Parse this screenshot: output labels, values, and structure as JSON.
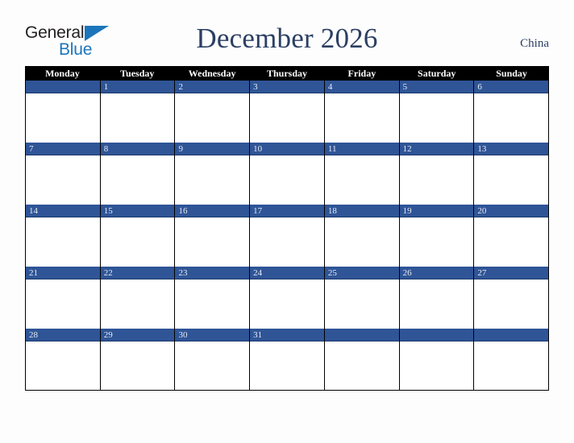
{
  "logo": {
    "word_primary": "General",
    "word_secondary": "Blue",
    "primary_color": "#231f20",
    "accent_color": "#1b75bb"
  },
  "header": {
    "title": "December 2026",
    "month": "December",
    "year": "2026",
    "country": "China",
    "title_color": "#2b3f63"
  },
  "calendar": {
    "weekdays": [
      "Monday",
      "Tuesday",
      "Wednesday",
      "Thursday",
      "Friday",
      "Saturday",
      "Sunday"
    ],
    "header_background": "#000000",
    "header_text_color": "#ffffff",
    "date_bar_color": "#2f5597",
    "date_text_color": "#e8ecf4",
    "cell_background": "#ffffff",
    "grid_line_color": "#000000",
    "weeks": [
      {
        "days": [
          {
            "date": ""
          },
          {
            "date": "1"
          },
          {
            "date": "2"
          },
          {
            "date": "3"
          },
          {
            "date": "4"
          },
          {
            "date": "5"
          },
          {
            "date": "6"
          }
        ]
      },
      {
        "days": [
          {
            "date": "7"
          },
          {
            "date": "8"
          },
          {
            "date": "9"
          },
          {
            "date": "10"
          },
          {
            "date": "11"
          },
          {
            "date": "12"
          },
          {
            "date": "13"
          }
        ]
      },
      {
        "days": [
          {
            "date": "14"
          },
          {
            "date": "15"
          },
          {
            "date": "16"
          },
          {
            "date": "17"
          },
          {
            "date": "18"
          },
          {
            "date": "19"
          },
          {
            "date": "20"
          }
        ]
      },
      {
        "days": [
          {
            "date": "21"
          },
          {
            "date": "22"
          },
          {
            "date": "23"
          },
          {
            "date": "24"
          },
          {
            "date": "25"
          },
          {
            "date": "26"
          },
          {
            "date": "27"
          }
        ]
      },
      {
        "days": [
          {
            "date": "28"
          },
          {
            "date": "29"
          },
          {
            "date": "30"
          },
          {
            "date": "31"
          },
          {
            "date": ""
          },
          {
            "date": ""
          },
          {
            "date": ""
          }
        ]
      }
    ]
  }
}
